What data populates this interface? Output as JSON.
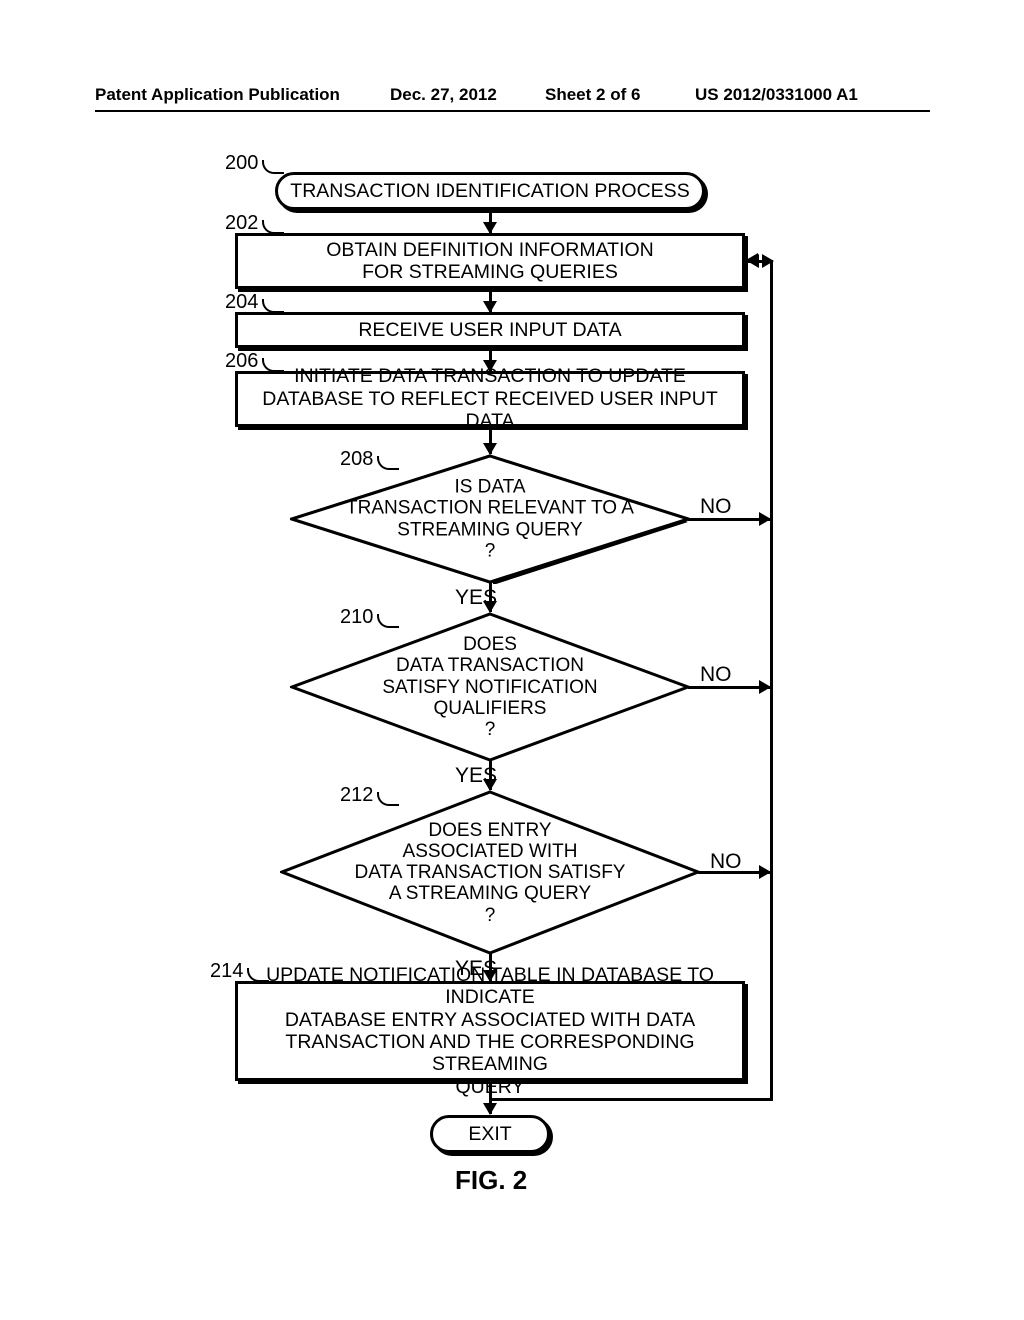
{
  "header": {
    "left": "Patent Application Publication",
    "date": "Dec. 27, 2012",
    "sheet": "Sheet 2 of 6",
    "pubno": "US 2012/0331000 A1"
  },
  "figure_caption": "FIG. 2",
  "refs": {
    "r200": "200",
    "r202": "202",
    "r204": "204",
    "r206": "206",
    "r208": "208",
    "r210": "210",
    "r212": "212",
    "r214": "214"
  },
  "nodes": {
    "start": "TRANSACTION IDENTIFICATION PROCESS",
    "n202": "OBTAIN DEFINITION INFORMATION\nFOR STREAMING QUERIES",
    "n204": "RECEIVE USER INPUT DATA",
    "n206": "INITIATE DATA TRANSACTION TO UPDATE\nDATABASE TO REFLECT RECEIVED USER INPUT DATA",
    "d208": "IS DATA\nTRANSACTION RELEVANT TO A\nSTREAMING QUERY\n?",
    "d210": "DOES\nDATA TRANSACTION\nSATISFY NOTIFICATION\nQUALIFIERS\n?",
    "d212": "DOES ENTRY\nASSOCIATED WITH\nDATA TRANSACTION SATISFY\nA STREAMING QUERY\n?",
    "n214": "UPDATE NOTIFICATION TABLE IN DATABASE TO INDICATE\nDATABASE ENTRY ASSOCIATED WITH DATA\nTRANSACTION AND THE CORRESPONDING STREAMING\nQUERY",
    "exit": "EXIT"
  },
  "branches": {
    "yes": "YES",
    "no": "NO"
  }
}
